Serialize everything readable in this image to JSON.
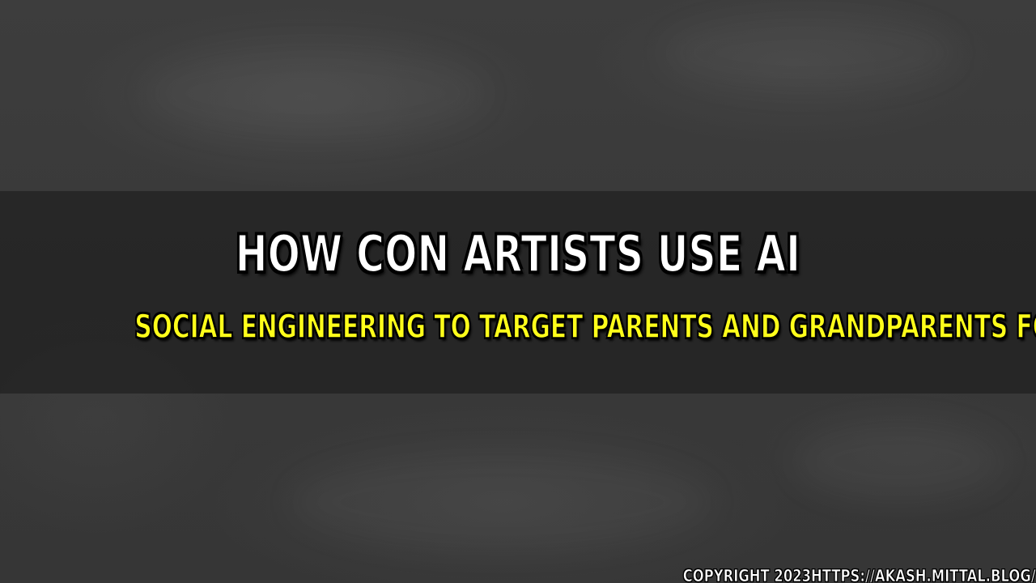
{
  "title": "HOW CON ARTISTS USE AI",
  "subtitle": "SOCIAL ENGINEERING TO TARGET PARENTS AND GRANDPARENTS FOR",
  "copyright": "COPYRIGHT 2023HTTPS://AKASH.MITTAL.BLOG/",
  "colors": {
    "title": "#ffffff",
    "subtitle": "#ffff1a",
    "band": "#1c1c1c",
    "background": "#3a3a3a"
  }
}
